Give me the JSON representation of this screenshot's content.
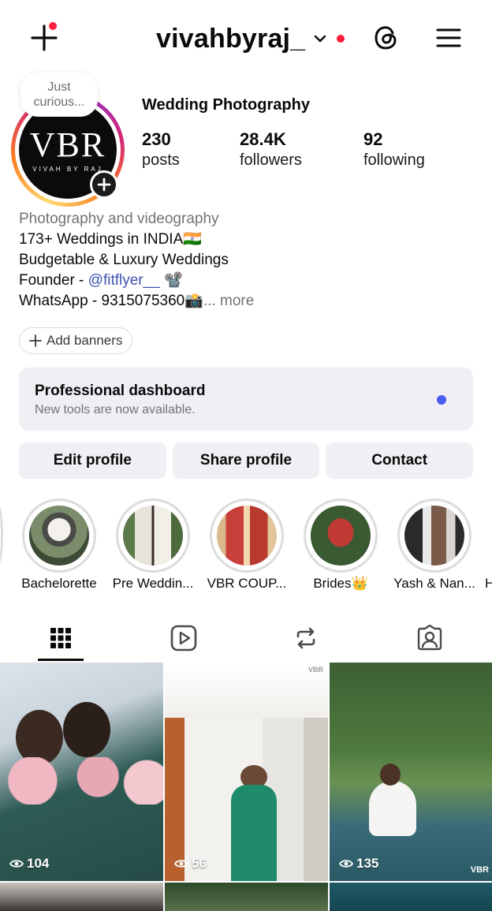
{
  "header": {
    "username": "vivahbyraj_",
    "notification_dot_color": "#ff1f3d"
  },
  "profile": {
    "note": [
      "Just",
      "curious..."
    ],
    "avatar_logo": "VBR",
    "avatar_logo_sub": "VIVAH BY RAJ",
    "display_name": "Wedding Photography",
    "stats": [
      {
        "value": "230",
        "label": "posts"
      },
      {
        "value": "28.4K",
        "label": "followers"
      },
      {
        "value": "92",
        "label": "following"
      }
    ]
  },
  "bio": {
    "category": "Photography and videography",
    "line1": "173+ Weddings in INDIA🇮🇳",
    "line2": "Budgetable & Luxury Weddings",
    "line3_prefix": "Founder - ",
    "line3_link": "@fitflyer__",
    "line3_suffix": " 📽️",
    "line4": "WhatsApp - 9315075360📸",
    "more_label": "... more"
  },
  "add_banners_label": "Add banners",
  "dashboard": {
    "title": "Professional dashboard",
    "subtitle": "New tools are now available.",
    "dot_color": "#4a5bf0"
  },
  "actions": {
    "edit": "Edit profile",
    "share": "Share profile",
    "contact": "Contact"
  },
  "highlights": [
    {
      "label": "Bachelorette"
    },
    {
      "label": "Pre Weddin..."
    },
    {
      "label": "VBR COUP..."
    },
    {
      "label": "Brides👑"
    },
    {
      "label": "Yash & Nan..."
    },
    {
      "label": "H"
    }
  ],
  "tabs": [
    "grid-tab",
    "reels-tab",
    "reposts-tab",
    "tagged-tab"
  ],
  "posts": [
    {
      "views": "104"
    },
    {
      "views": "56",
      "watermark": "VBR"
    },
    {
      "views": "135",
      "watermark": "VBR"
    }
  ]
}
